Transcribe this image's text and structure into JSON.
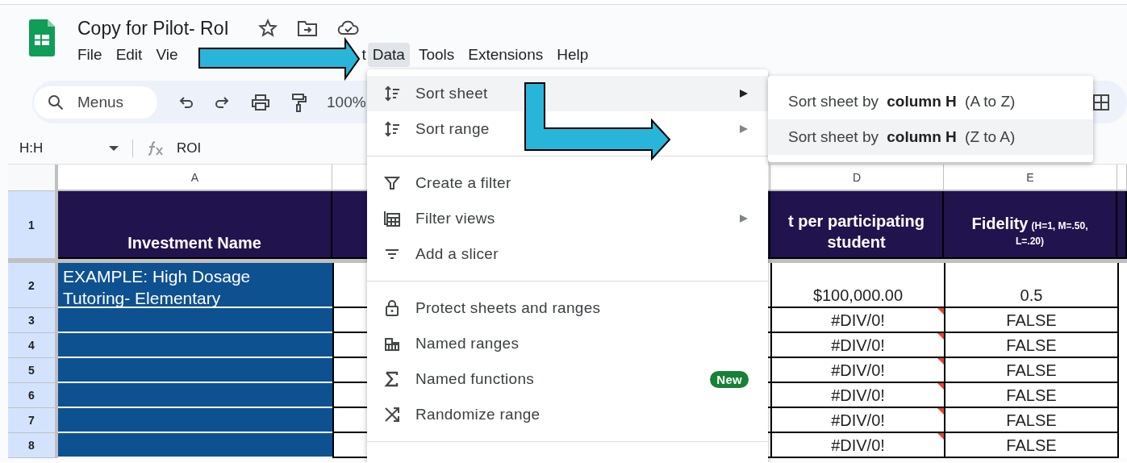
{
  "document": {
    "title": "Copy for Pilot- RoI"
  },
  "menubar": [
    {
      "label": "File",
      "selected": false,
      "kind": "full"
    },
    {
      "label": "Edit",
      "selected": false,
      "kind": "full"
    },
    {
      "label": "Vie",
      "selected": false,
      "kind": "tail-cut"
    },
    {
      "label": "t",
      "selected": false,
      "kind": "head-cut"
    },
    {
      "label": "Data",
      "selected": true,
      "kind": "full"
    },
    {
      "label": "Tools",
      "selected": false,
      "kind": "full"
    },
    {
      "label": "Extensions",
      "selected": false,
      "kind": "full"
    },
    {
      "label": "Help",
      "selected": false,
      "kind": "full"
    }
  ],
  "toolbar": {
    "search": {
      "placeholder": "Menus"
    },
    "zoom": "100%"
  },
  "formula_bar": {
    "name_box": "H:H",
    "formula": "ROI"
  },
  "grid": {
    "column_headers": [
      "A",
      "D",
      "E"
    ],
    "header_row": {
      "number": "1",
      "column_a": "Investment Name",
      "column_d": "t per participating student",
      "column_e_title": "Fidelity",
      "column_e_note": "(H=1, M=.50, L=.20)"
    },
    "rows": [
      {
        "number": "2",
        "column_a": "EXAMPLE: High Dosage Tutoring- Elementary",
        "column_d": "$100,000.00",
        "column_e": "0.5",
        "has_note": false
      },
      {
        "number": "3",
        "column_d": "#DIV/0!",
        "column_e": "FALSE",
        "has_note": true
      },
      {
        "number": "4",
        "column_d": "#DIV/0!",
        "column_e": "FALSE",
        "has_note": true
      },
      {
        "number": "5",
        "column_d": "#DIV/0!",
        "column_e": "FALSE",
        "has_note": true
      },
      {
        "number": "6",
        "column_d": "#DIV/0!",
        "column_e": "FALSE",
        "has_note": true
      },
      {
        "number": "7",
        "column_d": "#DIV/0!",
        "column_e": "FALSE",
        "has_note": true
      },
      {
        "number": "8",
        "column_d": "#DIV/0!",
        "column_e": "FALSE",
        "has_note": true
      }
    ]
  },
  "data_menu": {
    "items": [
      {
        "kind": "item",
        "label": "Sort sheet",
        "selected": true,
        "has_submenu": true
      },
      {
        "kind": "item",
        "label": "Sort range",
        "selected": false,
        "has_submenu": true
      },
      {
        "kind": "separator"
      },
      {
        "kind": "item",
        "label": "Create a filter",
        "selected": false,
        "has_submenu": false
      },
      {
        "kind": "item",
        "label": "Filter views",
        "selected": false,
        "has_submenu": true
      },
      {
        "kind": "item",
        "label": "Add a slicer",
        "selected": false,
        "has_submenu": false
      },
      {
        "kind": "separator"
      },
      {
        "kind": "item",
        "label": "Protect sheets and ranges",
        "selected": false,
        "has_submenu": false
      },
      {
        "kind": "item",
        "label": "Named ranges",
        "selected": false,
        "has_submenu": false
      },
      {
        "kind": "item",
        "label": "Named functions",
        "selected": false,
        "has_submenu": false,
        "badge": "New"
      },
      {
        "kind": "item",
        "label": "Randomize range",
        "selected": false,
        "has_submenu": false
      },
      {
        "kind": "separator"
      }
    ]
  },
  "sort_submenu": {
    "items": [
      {
        "label": "Sort sheet by **column H** (A to Z)",
        "selected": false
      },
      {
        "label": "Sort sheet by **column H** (Z to A)",
        "selected": true
      }
    ]
  }
}
